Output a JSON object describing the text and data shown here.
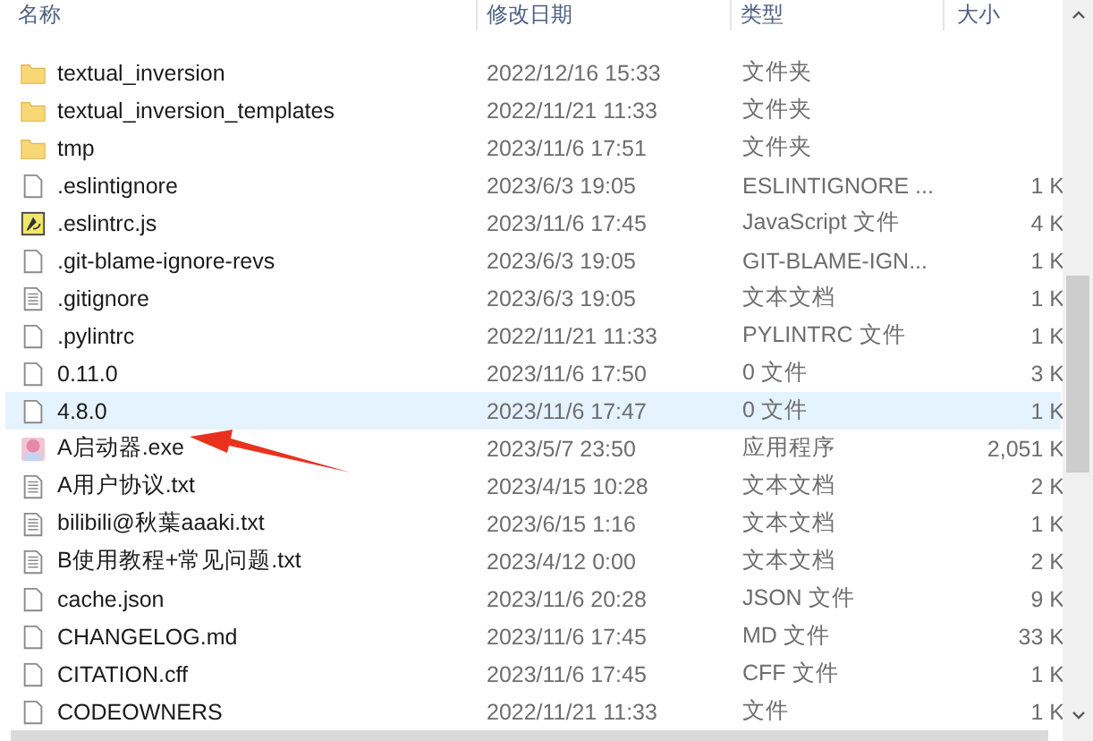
{
  "columns": [
    "名称",
    "修改日期",
    "类型",
    "大小"
  ],
  "rows": [
    {
      "kind": "folder",
      "name": "textual_inversion",
      "date": "2022/12/16 15:33",
      "type": "文件夹",
      "selected": false
    },
    {
      "kind": "folder",
      "name": "textual_inversion_templates",
      "date": "2022/11/21 11:33",
      "type": "文件夹",
      "selected": false
    },
    {
      "kind": "folder",
      "name": "tmp",
      "date": "2023/11/6 17:51",
      "type": "文件夹",
      "selected": false
    },
    {
      "kind": "file",
      "name": ".eslintignore",
      "date": "2023/6/3 19:05",
      "type": "ESLINTIGNORE ...",
      "size": "1 K",
      "selected": false
    },
    {
      "kind": "script",
      "name": ".eslintrc.js",
      "date": "2023/11/6 17:45",
      "type": "JavaScript 文件",
      "size": "4 K",
      "selected": false
    },
    {
      "kind": "file",
      "name": ".git-blame-ignore-revs",
      "date": "2023/6/3 19:05",
      "type": "GIT-BLAME-IGN...",
      "size": "1 K",
      "selected": false
    },
    {
      "kind": "text",
      "name": ".gitignore",
      "date": "2023/6/3 19:05",
      "type": "文本文档",
      "size": "1 K",
      "selected": false
    },
    {
      "kind": "file",
      "name": ".pylintrc",
      "date": "2022/11/21 11:33",
      "type": "PYLINTRC 文件",
      "size": "1 K",
      "selected": false
    },
    {
      "kind": "file",
      "name": "0.11.0",
      "date": "2023/11/6 17:50",
      "type": "0 文件",
      "size": "3 K",
      "selected": false
    },
    {
      "kind": "file",
      "name": "4.8.0",
      "date": "2023/11/6 17:47",
      "type": "0 文件",
      "size": "1 K",
      "selected": true
    },
    {
      "kind": "app",
      "name": "A启动器.exe",
      "date": "2023/5/7 23:50",
      "type": "应用程序",
      "size": "2,051 K",
      "selected": false
    },
    {
      "kind": "text",
      "name": "A用户协议.txt",
      "date": "2023/4/15 10:28",
      "type": "文本文档",
      "size": "2 K",
      "selected": false
    },
    {
      "kind": "text",
      "name": "bilibili@秋葉aaaki.txt",
      "date": "2023/6/15 1:16",
      "type": "文本文档",
      "size": "1 K",
      "selected": false
    },
    {
      "kind": "text",
      "name": "B使用教程+常见问题.txt",
      "date": "2023/4/12 0:00",
      "type": "文本文档",
      "size": "2 K",
      "selected": false
    },
    {
      "kind": "file",
      "name": "cache.json",
      "date": "2023/11/6 20:28",
      "type": "JSON 文件",
      "size": "9 K",
      "selected": false
    },
    {
      "kind": "file",
      "name": "CHANGELOG.md",
      "date": "2023/11/6 17:45",
      "type": "MD 文件",
      "size": "33 K",
      "selected": false
    },
    {
      "kind": "file",
      "name": "CITATION.cff",
      "date": "2023/11/6 17:45",
      "type": "CFF 文件",
      "size": "1 K",
      "selected": false
    },
    {
      "kind": "file",
      "name": "CODEOWNERS",
      "date": "2022/11/21 11:33",
      "type": "文件",
      "size": "1 K",
      "selected": false
    }
  ]
}
